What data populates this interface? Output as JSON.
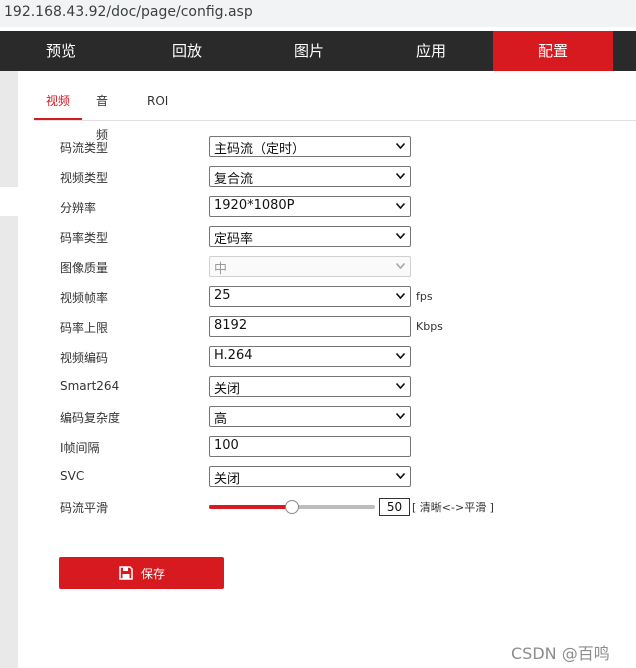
{
  "address": "192.168.43.92/doc/page/config.asp",
  "nav": [
    "预览",
    "回放",
    "图片",
    "应用",
    "配置"
  ],
  "tabs": [
    "视频",
    "音频",
    "ROI"
  ],
  "form": {
    "stream_type": {
      "label": "码流类型",
      "value": "主码流（定时）"
    },
    "video_type": {
      "label": "视频类型",
      "value": "复合流"
    },
    "resolution": {
      "label": "分辨率",
      "value": "1920*1080P"
    },
    "bitrate_type": {
      "label": "码率类型",
      "value": "定码率"
    },
    "image_quality": {
      "label": "图像质量",
      "value": "中"
    },
    "frame_rate": {
      "label": "视频帧率",
      "value": "25",
      "unit": "fps"
    },
    "max_bitrate": {
      "label": "码率上限",
      "value": "8192",
      "unit": "Kbps"
    },
    "video_encoding": {
      "label": "视频编码",
      "value": "H.264"
    },
    "smart264": {
      "label": "Smart264",
      "value": "关闭"
    },
    "encoding_complexity": {
      "label": "编码复杂度",
      "value": "高"
    },
    "i_frame_interval": {
      "label": "I帧间隔",
      "value": "100"
    },
    "svc": {
      "label": "SVC",
      "value": "关闭"
    },
    "smoothing": {
      "label": "码流平滑",
      "value": "50",
      "fraction": 0.5,
      "hint": "[ 清晰<->平滑 ]"
    }
  },
  "save_label": "保存",
  "watermark": "CSDN @百鸣",
  "colors": {
    "accent": "#d71920",
    "nav_bg": "#2a2a2a"
  }
}
